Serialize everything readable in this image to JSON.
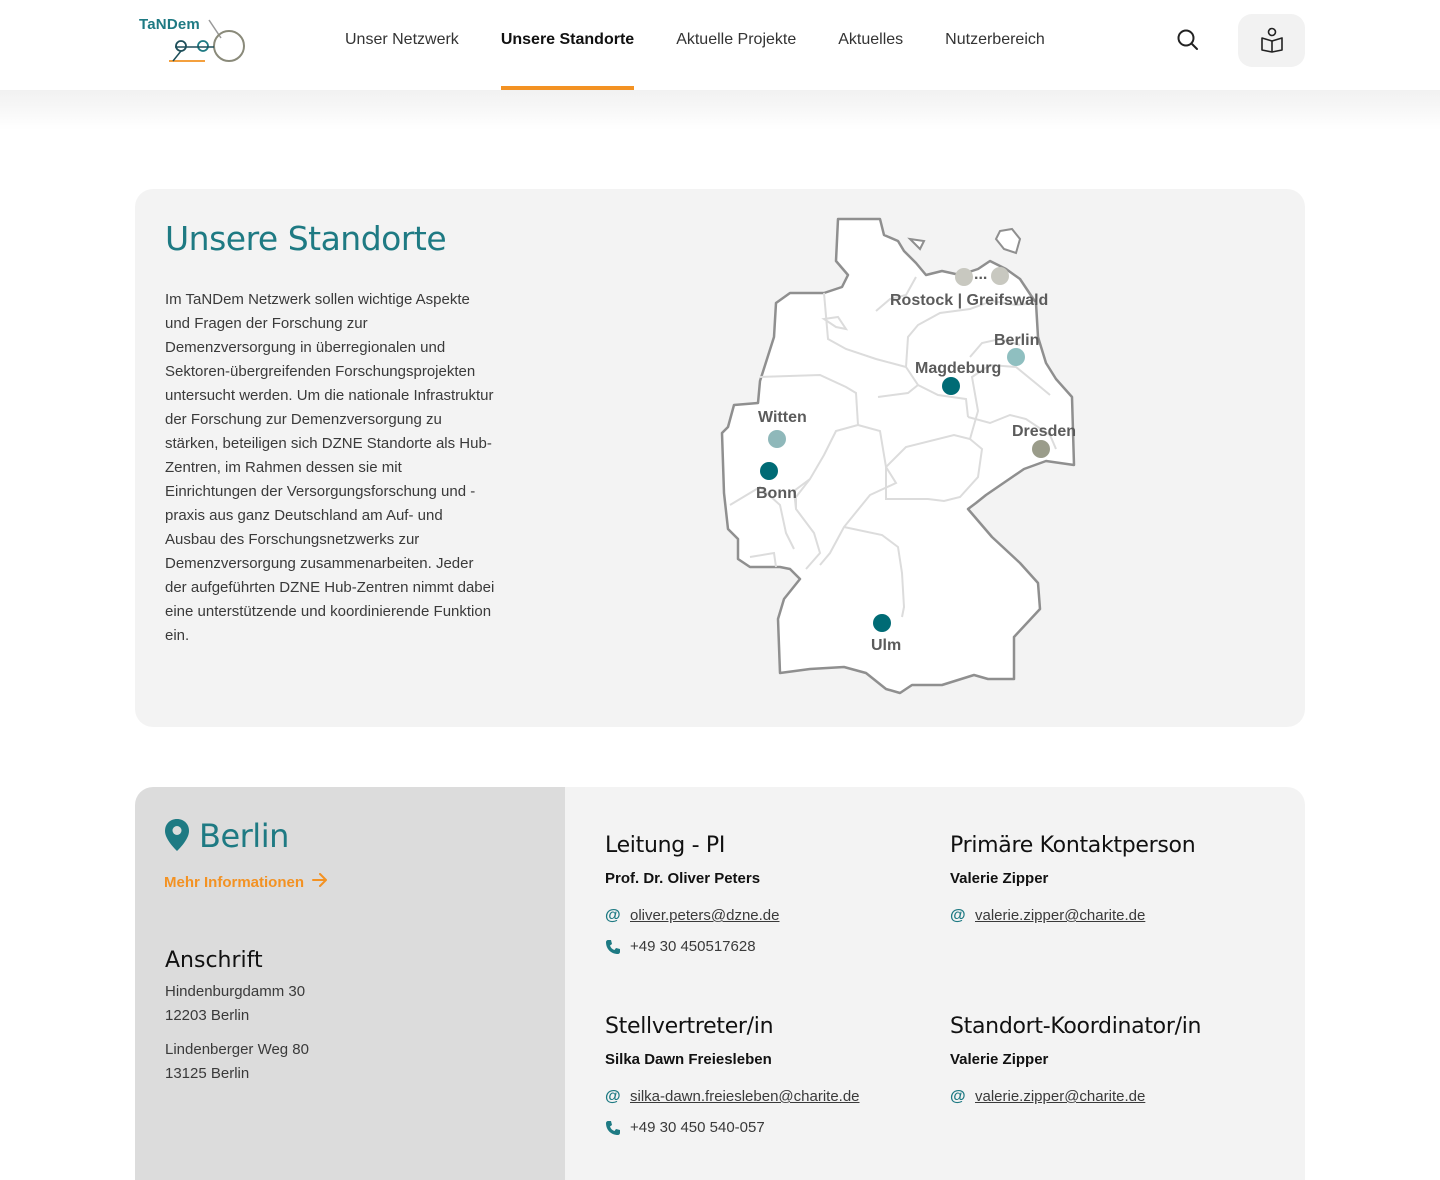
{
  "header": {
    "logo_text": "TaNDem",
    "nav": [
      {
        "label": "Unser Netzwerk",
        "active": false
      },
      {
        "label": "Unsere Standorte",
        "active": true
      },
      {
        "label": "Aktuelle Projekte",
        "active": false
      },
      {
        "label": "Aktuelles",
        "active": false
      },
      {
        "label": "Nutzerbereich",
        "active": false
      }
    ],
    "icons": {
      "search": "search-icon",
      "account": "book-reader-icon"
    }
  },
  "intro": {
    "title": "Unsere Standorte",
    "text": "Im TaNDem Netzwerk sollen wichtige Aspekte und Fragen der Forschung zur Demenzversorgung in überregionalen und Sektoren-übergreifenden Forschungsprojekten untersucht werden. Um die nationale Infrastruktur der Forschung zur Demenzversorgung zu stärken, beteiligen sich DZNE Standorte als Hub-Zentren, im Rahmen dessen sie mit Einrichtungen der Versorgungsforschung und -praxis aus ganz Deutschland am Auf- und Ausbau des Forschungsnetzwerks zur Demenzversorgung zusammenarbeiten. Jeder der aufgeführten DZNE Hub-Zentren nimmt dabei eine unterstützende und koordinierende Funktion ein."
  },
  "map": {
    "cities": [
      {
        "label": "Rostock | Greifswald",
        "color": "#c8c8c0"
      },
      {
        "label": "Berlin",
        "color": "#8fbfc0"
      },
      {
        "label": "Magdeburg",
        "color": "#006b75"
      },
      {
        "label": "Witten",
        "color": "#8fb8ba"
      },
      {
        "label": "Bonn",
        "color": "#006b75"
      },
      {
        "label": "Dresden",
        "color": "#9a9c8a"
      },
      {
        "label": "Ulm",
        "color": "#006b75"
      }
    ],
    "ellipsis": "..."
  },
  "location": {
    "city": "Berlin",
    "more_link": "Mehr Informationen",
    "address_heading": "Anschrift",
    "addresses": [
      {
        "street": "Hindenburgdamm 30",
        "city": "12203 Berlin"
      },
      {
        "street": "Lindenberger Weg 80",
        "city": "13125 Berlin"
      }
    ],
    "contacts": [
      {
        "role": "Leitung - PI",
        "name": "Prof. Dr. Oliver Peters",
        "email": "oliver.peters@dzne.de",
        "phone": "+49 30 450517628"
      },
      {
        "role": "Primäre Kontaktperson",
        "name": "Valerie Zipper",
        "email": "valerie.zipper@charite.de",
        "phone": ""
      },
      {
        "role": "Stellvertreter/in",
        "name": "Silka Dawn Freiesleben",
        "email": "silka-dawn.freiesleben@charite.de",
        "phone": "+49 30 450 540-057"
      },
      {
        "role": "Standort-Koordinator/in",
        "name": "Valerie Zipper",
        "email": "valerie.zipper@charite.de",
        "phone": ""
      }
    ],
    "email_symbol": "@",
    "colors": {
      "accent": "#1e7a83",
      "link_orange": "#f39223"
    }
  }
}
